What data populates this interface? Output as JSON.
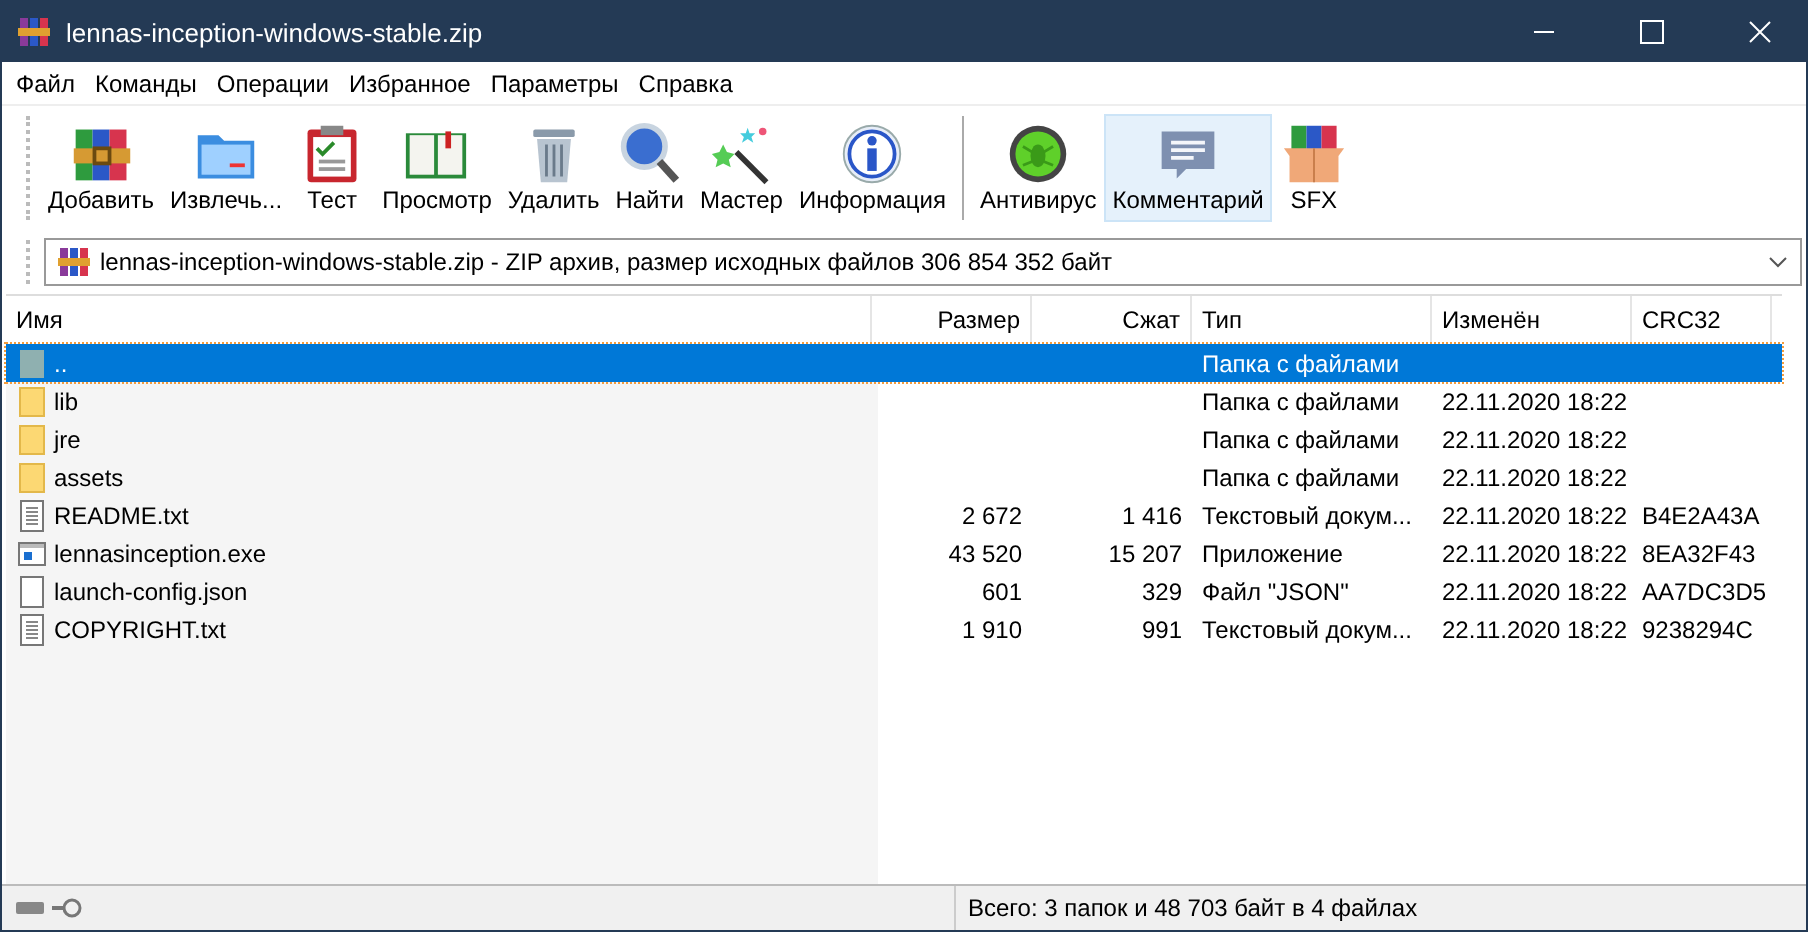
{
  "window": {
    "title": "lennas-inception-windows-stable.zip"
  },
  "menu": [
    "Файл",
    "Команды",
    "Операции",
    "Избранное",
    "Параметры",
    "Справка"
  ],
  "toolbar": [
    {
      "kind": "button",
      "label": "Добавить",
      "highlighted": false
    },
    {
      "kind": "button",
      "label": "Извлечь...",
      "highlighted": false
    },
    {
      "kind": "button",
      "label": "Тест",
      "highlighted": false
    },
    {
      "kind": "button",
      "label": "Просмотр",
      "highlighted": false
    },
    {
      "kind": "button",
      "label": "Удалить",
      "highlighted": false
    },
    {
      "kind": "button",
      "label": "Найти",
      "highlighted": false
    },
    {
      "kind": "button",
      "label": "Мастер",
      "highlighted": false
    },
    {
      "kind": "button",
      "label": "Информация",
      "highlighted": false
    },
    {
      "kind": "separator"
    },
    {
      "kind": "button",
      "label": "Антивирус",
      "highlighted": false
    },
    {
      "kind": "button",
      "label": "Комментарий",
      "highlighted": true
    },
    {
      "kind": "button",
      "label": "SFX",
      "highlighted": false
    }
  ],
  "address": {
    "value": "lennas-inception-windows-stable.zip - ZIP архив, размер исходных файлов 306 854 352 байт"
  },
  "table": {
    "columns": [
      "Имя",
      "Размер",
      "Сжат",
      "Тип",
      "Изменён",
      "CRC32"
    ],
    "rows": [
      {
        "kind": "parent",
        "selected": true,
        "name": "..",
        "type": "Папка с файлами"
      },
      {
        "kind": "folder",
        "selected": false,
        "name": "lib",
        "type": "Папка с файлами",
        "modified": "22.11.2020 18:22"
      },
      {
        "kind": "folder",
        "selected": false,
        "name": "jre",
        "type": "Папка с файлами",
        "modified": "22.11.2020 18:22"
      },
      {
        "kind": "folder",
        "selected": false,
        "name": "assets",
        "type": "Папка с файлами",
        "modified": "22.11.2020 18:22"
      },
      {
        "kind": "text",
        "selected": false,
        "name": "README.txt",
        "size": "2 672",
        "packed": "1 416",
        "type": "Текстовый докум...",
        "modified": "22.11.2020 18:22",
        "crc": "B4E2A43A"
      },
      {
        "kind": "exe",
        "selected": false,
        "name": "lennasinception.exe",
        "size": "43 520",
        "packed": "15 207",
        "type": "Приложение",
        "modified": "22.11.2020 18:22",
        "crc": "8EA32F43"
      },
      {
        "kind": "file",
        "selected": false,
        "name": "launch-config.json",
        "size": "601",
        "packed": "329",
        "type": "Файл \"JSON\"",
        "modified": "22.11.2020 18:22",
        "crc": "AA7DC3D5"
      },
      {
        "kind": "text",
        "selected": false,
        "name": "COPYRIGHT.txt",
        "size": "1 910",
        "packed": "991",
        "type": "Текстовый докум...",
        "modified": "22.11.2020 18:22",
        "crc": "9238294C"
      }
    ]
  },
  "status_bar": {
    "text": "Всего: 3 папок и 48 703 байт в 4 файлах"
  }
}
